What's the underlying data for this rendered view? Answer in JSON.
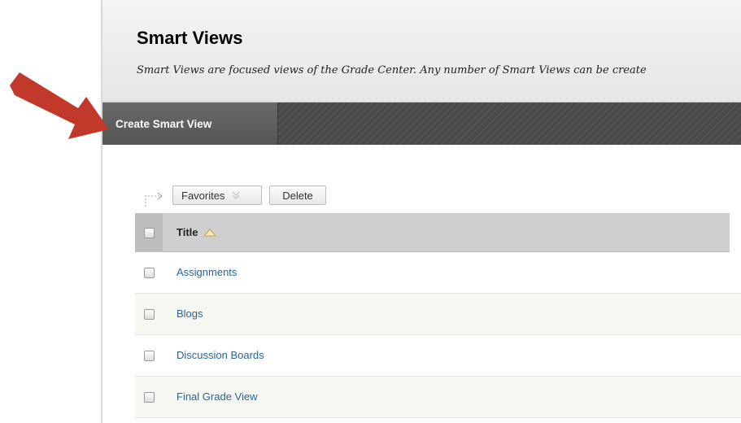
{
  "header": {
    "title": "Smart Views",
    "description": "Smart Views are focused views of the Grade Center. Any number of Smart Views can be create"
  },
  "action_bar": {
    "create_label": "Create Smart View"
  },
  "toolbar": {
    "favorites_label": "Favorites",
    "delete_label": "Delete"
  },
  "table": {
    "columns": [
      {
        "label": "Title",
        "sort": "ascending"
      }
    ],
    "rows": [
      {
        "title": "Assignments"
      },
      {
        "title": "Blogs"
      },
      {
        "title": "Discussion Boards"
      },
      {
        "title": "Final Grade View"
      }
    ]
  },
  "colors": {
    "arrow": "#c0392b",
    "action_bar": "#4a4a4a",
    "link": "#2a6496"
  },
  "icons": [
    "annotation-arrow-icon",
    "connector-arrow-icon",
    "chevron-down-icon",
    "sort-ascending-icon"
  ]
}
